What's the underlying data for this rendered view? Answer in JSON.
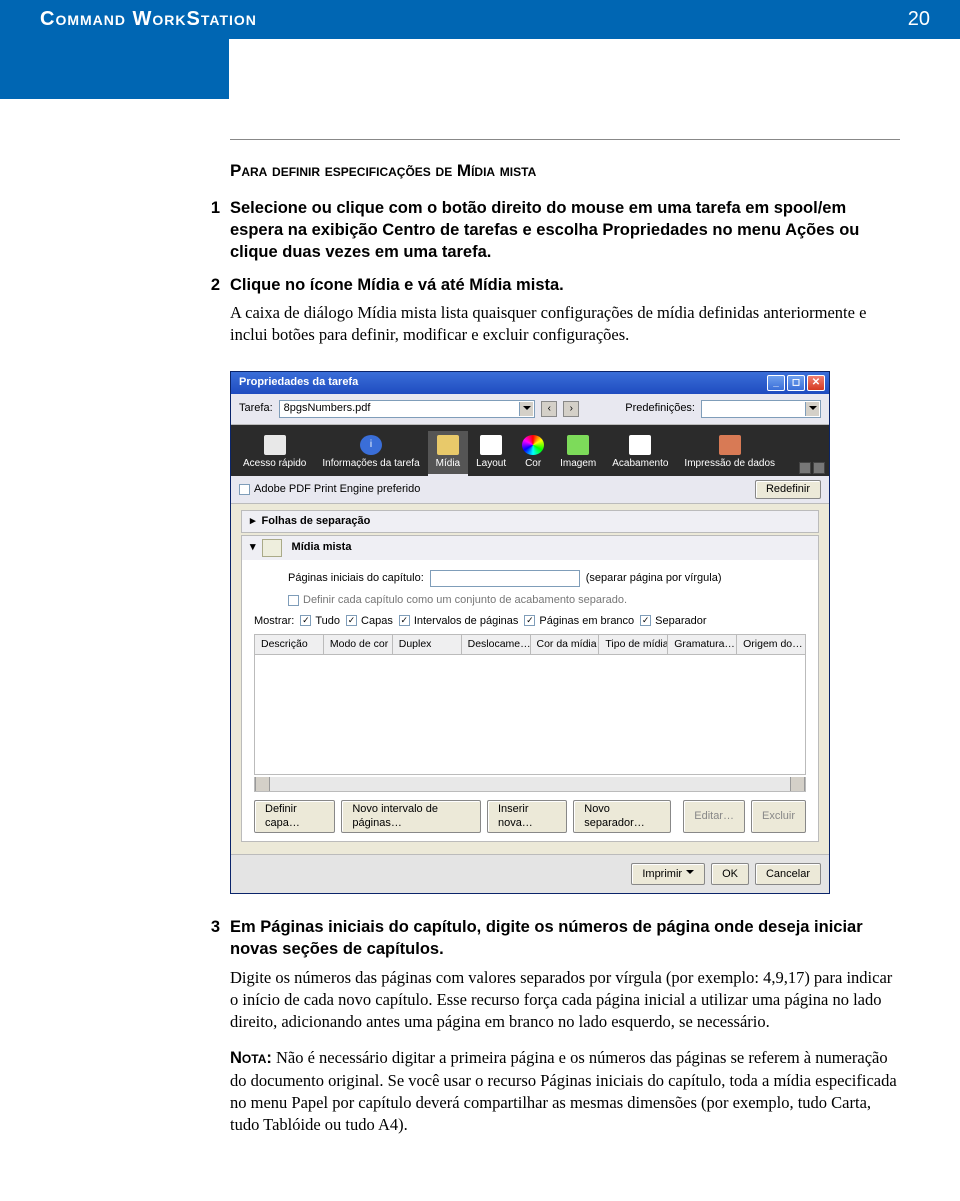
{
  "header": {
    "title": "Command WorkStation",
    "page": "20"
  },
  "section_title": "Para definir especificações de Mídia mista",
  "steps": [
    {
      "num": "1",
      "bold": "Selecione ou clique com o botão direito do mouse em uma tarefa em spool/em espera na exibição Centro de tarefas e escolha Propriedades no menu Ações ou clique duas vezes em uma tarefa."
    },
    {
      "num": "2",
      "bold": "Clique no ícone Mídia e vá até Mídia mista.",
      "body": "A caixa de diálogo Mídia mista lista quaisquer configurações de mídia definidas anteriormente e inclui botões para definir, modificar e excluir configurações."
    },
    {
      "num": "3",
      "bold": "Em Páginas iniciais do capítulo, digite os números de página onde deseja iniciar novas seções de capítulos.",
      "body": "Digite os números das páginas com valores separados por vírgula (por exemplo: 4,9,17) para indicar o início de cada novo capítulo. Esse recurso força cada página inicial a utilizar uma página no lado direito, adicionando antes uma página em branco no lado esquerdo, se necessário."
    }
  ],
  "note": {
    "label": "Nota:",
    "text": " Não é necessário digitar a primeira página e os números das páginas se referem à numeração do documento original. Se você usar o recurso Páginas iniciais do capítulo, toda a mídia especificada no menu Papel por capítulo deverá compartilhar as mesmas dimensões (por exemplo, tudo Carta, tudo Tablóide ou tudo A4)."
  },
  "dialog": {
    "title": "Propriedades da tarefa",
    "task_label": "Tarefa:",
    "task_value": "8pgsNumbers.pdf",
    "preset_label": "Predefinições:",
    "tabs": [
      "Acesso rápido",
      "Informações da tarefa",
      "Mídia",
      "Layout",
      "Cor",
      "Imagem",
      "Acabamento",
      "Impressão de dados"
    ],
    "active_tab": 2,
    "adobe_label": "Adobe PDF Print Engine preferido",
    "redefine": "Redefinir",
    "exp1": "Folhas de separação",
    "exp2": "Mídia mista",
    "chap_label": "Páginas iniciais do capítulo:",
    "chap_hint": "(separar página por vírgula)",
    "finish_label": "Definir cada capítulo como um conjunto de acabamento separado.",
    "show_label": "Mostrar:",
    "show_opts": [
      "Tudo",
      "Capas",
      "Intervalos de páginas",
      "Páginas em branco",
      "Separador"
    ],
    "columns": [
      "Descrição",
      "Modo de cor",
      "Duplex",
      "Deslocame…",
      "Cor da mídia",
      "Tipo de mídia",
      "Gramatura…",
      "Origem do…"
    ],
    "btns": [
      "Definir capa…",
      "Novo intervalo de páginas…",
      "Inserir nova…",
      "Novo separador…",
      "Editar…",
      "Excluir"
    ],
    "footer_btns": [
      "Imprimir",
      "OK",
      "Cancelar"
    ]
  }
}
